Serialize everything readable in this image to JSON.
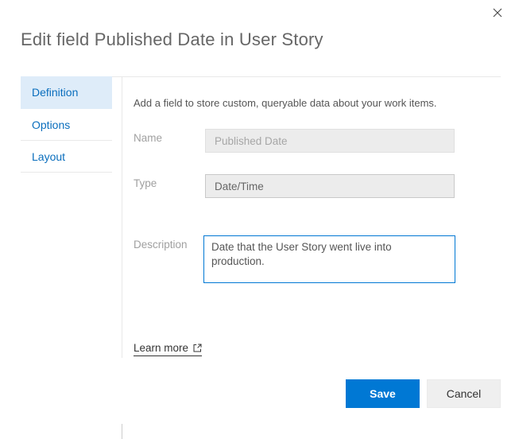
{
  "dialog": {
    "title": "Edit field Published Date in User Story",
    "tabs": [
      {
        "label": "Definition",
        "selected": true
      },
      {
        "label": "Options",
        "selected": false
      },
      {
        "label": "Layout",
        "selected": false
      }
    ],
    "content": {
      "intro": "Add a field to store custom, queryable data about your work items.",
      "fields": {
        "name": {
          "label": "Name",
          "value": "Published Date",
          "disabled": true
        },
        "type": {
          "label": "Type",
          "value": "Date/Time",
          "disabled": true
        },
        "description": {
          "label": "Description",
          "value": "Date that the User Story went live into production.",
          "disabled": false
        }
      },
      "learn_more_label": "Learn more"
    },
    "footer": {
      "save_label": "Save",
      "cancel_label": "Cancel"
    },
    "icons": {
      "close": "close-x-icon",
      "external_link": "external-link-icon"
    },
    "colors": {
      "accent": "#0078d4",
      "selected_tab_bg": "#deecf9",
      "disabled_input_bg": "#ececec",
      "tab_text": "#0a6ebd"
    }
  }
}
